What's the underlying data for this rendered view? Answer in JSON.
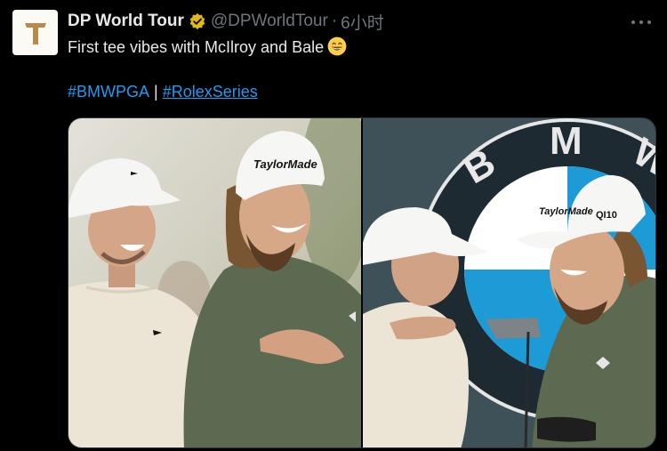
{
  "account": {
    "name": "DP World Tour",
    "handle": "@DPWorldTour",
    "separator": "·",
    "time": "6小时",
    "avatar_letter": "T",
    "verified_color": "#e2b719"
  },
  "tweet": {
    "text": "First tee vibes with McIlroy and Bale",
    "emoji": "grinning-face-emoji",
    "hashtags": [
      "#BMWPGA",
      "#RolexSeries"
    ],
    "hashtag_separator": "|",
    "link_color": "#1d9bf0"
  },
  "media": {
    "left_photo": {
      "cap_logo_text": "TaylorMade",
      "description_icon": "golfers-photo"
    },
    "right_photo": {
      "sign_letters": [
        "B",
        "M",
        "W"
      ],
      "cap_logo_text": "TaylorMade",
      "cap_side_text": "QI10"
    }
  }
}
